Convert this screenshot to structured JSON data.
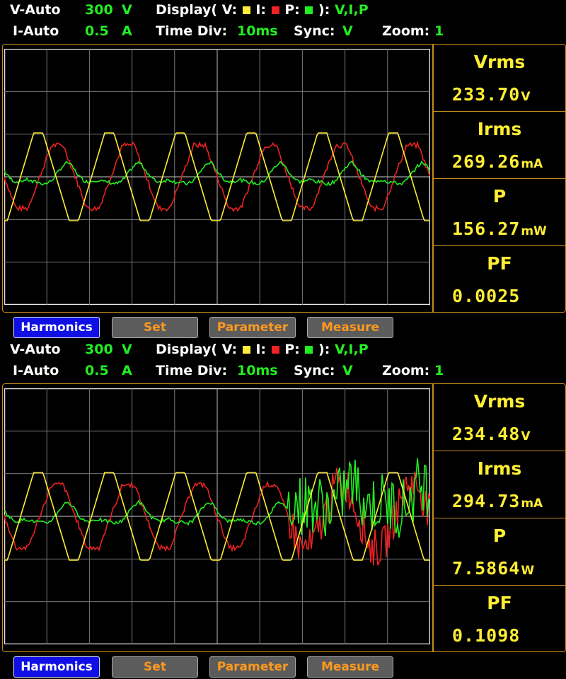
{
  "colors": {
    "voltage": "#ffee33",
    "current": "#ee2222",
    "power": "#22ee22",
    "accent": "#c88a1e",
    "grid": "#777777"
  },
  "panels": [
    {
      "header": {
        "v_range_label": "V-Auto",
        "v_range_value": "300",
        "v_range_unit": "V",
        "i_range_label": "I-Auto",
        "i_range_value": "0.5",
        "i_range_unit": "A",
        "display_label": "Display( V:",
        "display_i": "I:",
        "display_p": "P:",
        "display_close": "):",
        "display_value": "V,I,P",
        "time_div_label": "Time  Div:",
        "time_div_value": "10ms",
        "sync_label": "Sync:",
        "sync_value": "V",
        "zoom_label": "Zoom:",
        "zoom_value": "1"
      },
      "measurements": [
        {
          "label": "Vrms",
          "value": "233.70",
          "unit": "V"
        },
        {
          "label": "Irms",
          "value": "269.26",
          "unit": "mA"
        },
        {
          "label": "P",
          "value": "156.27",
          "unit": "mW"
        },
        {
          "label": "PF",
          "value": "0.0025",
          "unit": ""
        }
      ],
      "buttons": [
        "Harmonics",
        "Set",
        "Parameter",
        "Measure"
      ],
      "active_button": "Harmonics",
      "waveform": {
        "cycles": 6,
        "noisy_from_cycle": null
      }
    },
    {
      "header": {
        "v_range_label": "V-Auto",
        "v_range_value": "300",
        "v_range_unit": "V",
        "i_range_label": "I-Auto",
        "i_range_value": "0.5",
        "i_range_unit": "A",
        "display_label": "Display( V:",
        "display_i": "I:",
        "display_p": "P:",
        "display_close": "):",
        "display_value": "V,I,P",
        "time_div_label": "Time  Div:",
        "time_div_value": "10ms",
        "sync_label": "Sync:",
        "sync_value": "V",
        "zoom_label": "Zoom:",
        "zoom_value": "1"
      },
      "measurements": [
        {
          "label": "Vrms",
          "value": "234.48",
          "unit": "V"
        },
        {
          "label": "Irms",
          "value": "294.73",
          "unit": "mA"
        },
        {
          "label": "P",
          "value": "7.5864",
          "unit": "W"
        },
        {
          "label": "PF",
          "value": "0.1098",
          "unit": ""
        }
      ],
      "buttons": [
        "Harmonics",
        "Set",
        "Parameter",
        "Measure"
      ],
      "active_button": "Harmonics",
      "waveform": {
        "cycles": 6,
        "noisy_from_cycle": 4
      }
    }
  ]
}
